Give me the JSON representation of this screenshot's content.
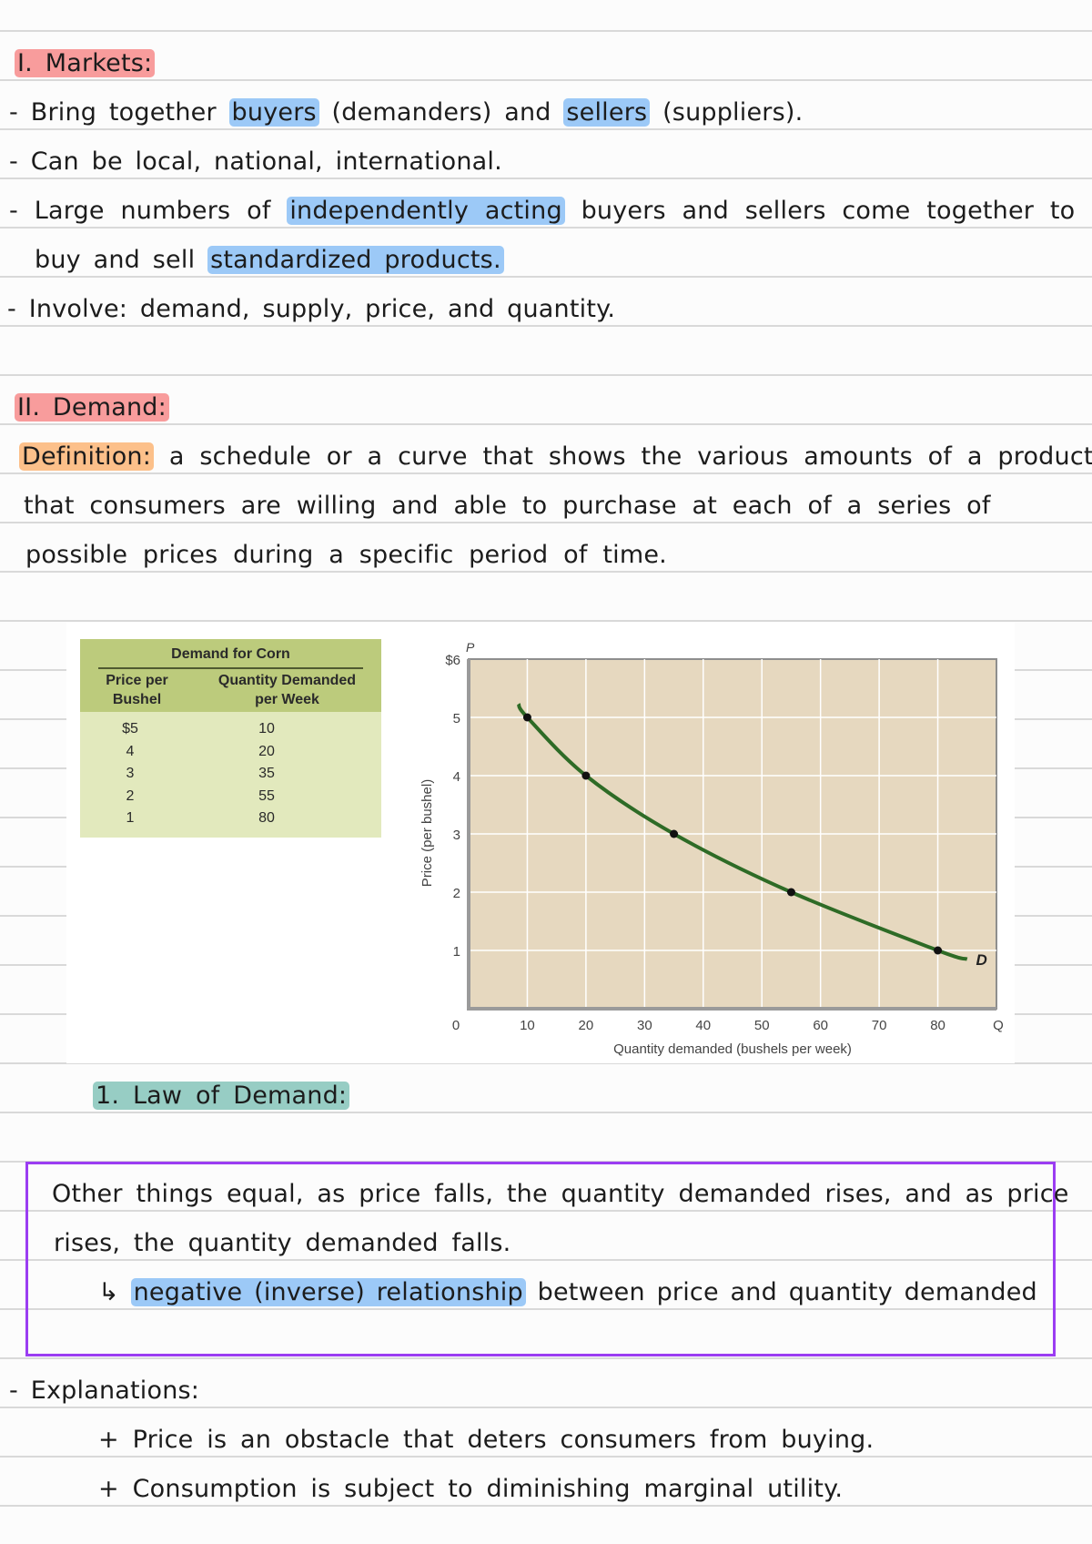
{
  "section1": {
    "heading": "I. Markets:",
    "bullets": [
      {
        "prefix": "- Bring together ",
        "hl1": "buyers",
        "mid": " (demanders) and ",
        "hl2": "sellers",
        "suffix": " (suppliers)."
      },
      {
        "text": "- Can be local, national, international."
      },
      {
        "prefix": "- Large numbers of ",
        "hl": "independently acting",
        "suffix": " buyers and sellers come together to"
      },
      {
        "prefix": "buy and sell ",
        "hl": "standardized products."
      },
      {
        "text": "- Involve: demand, supply, price, and quantity."
      }
    ]
  },
  "section2": {
    "heading": "II. Demand:",
    "definition_label": "Definition:",
    "definition_lines": [
      " a schedule or a curve that shows the various amounts of a product",
      "that consumers are willing and able to purchase at each of a series of",
      "possible prices during a specific period of time."
    ]
  },
  "table": {
    "title": "Demand for Corn",
    "col1": [
      "Price per",
      "Bushel"
    ],
    "col2": [
      "Quantity Demanded",
      "per Week"
    ],
    "rows": [
      {
        "price": "$5",
        "qty": "10"
      },
      {
        "price": "4",
        "qty": "20"
      },
      {
        "price": "3",
        "qty": "35"
      },
      {
        "price": "2",
        "qty": "55"
      },
      {
        "price": "1",
        "qty": "80"
      }
    ]
  },
  "chart_data": {
    "type": "line",
    "title": "",
    "xlabel": "Quantity demanded (bushels per week)",
    "ylabel": "Price (per bushel)",
    "x_axis_symbol": "Q",
    "y_axis_symbol": "P",
    "xlim": [
      0,
      90
    ],
    "ylim": [
      0,
      6
    ],
    "x_ticks": [
      "0",
      "10",
      "20",
      "30",
      "40",
      "50",
      "60",
      "70",
      "80"
    ],
    "y_ticks": [
      "1",
      "2",
      "3",
      "4",
      "5",
      "$6"
    ],
    "grid": true,
    "series": [
      {
        "name": "D",
        "x": [
          10,
          20,
          35,
          55,
          80
        ],
        "y": [
          5,
          4,
          3,
          2,
          1
        ],
        "color": "#2e6b26"
      }
    ],
    "curve_label": "D",
    "plot_background": "#e6d8bf"
  },
  "law": {
    "heading": "1. Law of Demand:",
    "box_lines": [
      "Other things equal, as price falls, the quantity demanded rises, and as price",
      "rises, the quantity demanded falls."
    ],
    "arrow": "↳",
    "relationship_hl": "negative (inverse) relationship",
    "relationship_rest": " between price and quantity demanded",
    "box_color": "#9b3df2"
  },
  "explanations": {
    "heading": "- Explanations:",
    "items": [
      "+ Price is an obstacle that deters consumers from buying.",
      "+ Consumption is subject to diminishing marginal utility."
    ]
  }
}
